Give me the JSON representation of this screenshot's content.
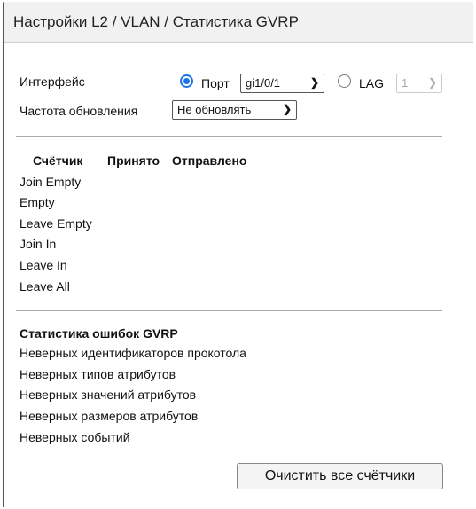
{
  "page": {
    "title": "Настройки L2 / VLAN / Статистика GVRP"
  },
  "interface": {
    "label": "Интерфейс",
    "port_label": "Порт",
    "port_value": "gi1/0/1",
    "lag_label": "LAG",
    "lag_value": "1"
  },
  "refresh": {
    "label": "Частота обновления",
    "value": "Не обновлять"
  },
  "counters": {
    "headers": [
      "Счётчик",
      "Принято",
      "Отправлено"
    ],
    "rows": [
      "Join Empty",
      "Empty",
      "Leave Empty",
      "Join In",
      "Leave In",
      "Leave All"
    ]
  },
  "errors": {
    "title": "Статистика ошибок GVRP",
    "rows": [
      "Неверных идентификаторов прокотола",
      "Неверных типов атрибутов",
      "Неверных значений атрибутов",
      "Неверных размеров атрибутов",
      "Неверных событий"
    ]
  },
  "actions": {
    "clear_all": "Очистить все счётчики"
  },
  "colors": {
    "accent": "#1a73e8"
  }
}
